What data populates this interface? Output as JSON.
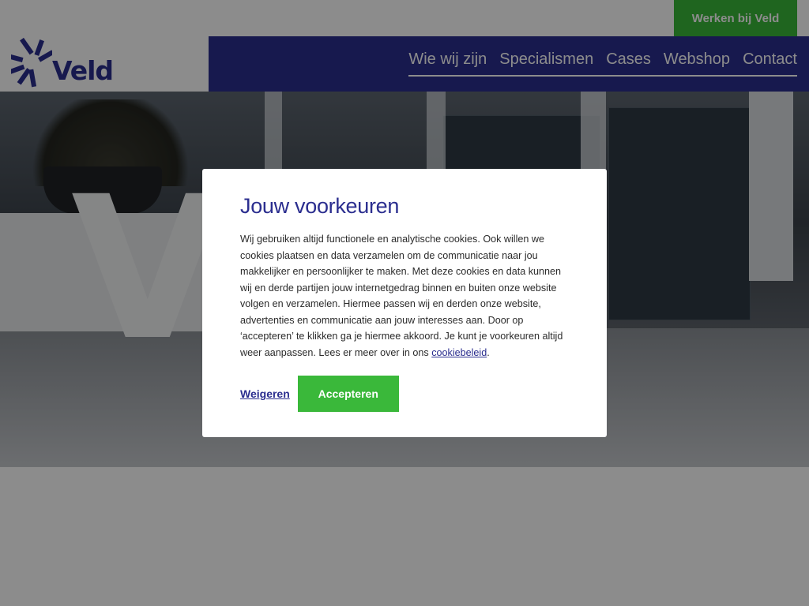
{
  "header": {
    "careers_label": "Werken bij Veld",
    "logo_text": "Veld",
    "nav": [
      {
        "label": "Wie wij zijn"
      },
      {
        "label": "Specialismen"
      },
      {
        "label": "Cases"
      },
      {
        "label": "Webshop"
      },
      {
        "label": "Contact"
      }
    ]
  },
  "hero": {
    "letters": "VC"
  },
  "cookie_modal": {
    "title": "Jouw voorkeuren",
    "body": "Wij gebruiken altijd functionele en analytische cookies. Ook willen we cookies plaatsen en data verzamelen om de communicatie naar jou makkelijker en persoonlijker te maken. Met deze cookies en data kunnen wij en derde partijen jouw internetgedrag binnen en buiten onze website volgen en verzamelen. Hiermee passen wij en derden onze website, advertenties en communicatie aan jouw interesses aan. Door op ‘accepteren’ te klikken ga je hiermee akkoord. Je kunt je voorkeuren altijd weer aanpassen. Lees er meer over in ons ",
    "policy_link": "cookiebeleid",
    "body_end": ".",
    "decline_label": "Weigeren",
    "accept_label": "Accepteren"
  },
  "colors": {
    "brand_blue": "#2b2e8f",
    "brand_green": "#3ab83a"
  }
}
